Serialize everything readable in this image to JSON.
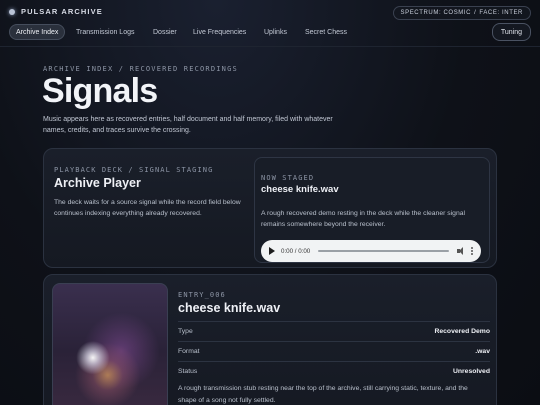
{
  "brand": {
    "name": "PULSAR ARCHIVE"
  },
  "status_pill": {
    "spectrum": "SPECTRUM: COSMIC",
    "separator": "/",
    "face": "FACE: INTER"
  },
  "nav": {
    "items": [
      {
        "label": "Archive Index",
        "active": true
      },
      {
        "label": "Transmission Logs",
        "active": false
      },
      {
        "label": "Dossier",
        "active": false
      },
      {
        "label": "Live Frequencies",
        "active": false
      },
      {
        "label": "Uplinks",
        "active": false
      },
      {
        "label": "Secret Chess",
        "active": false
      }
    ],
    "tuning_label": "Tuning"
  },
  "header": {
    "eyebrow": "ARCHIVE INDEX / RECOVERED RECORDINGS",
    "title": "Signals",
    "intro": "Music appears here as recovered entries, half document and half memory, filed with whatever names, credits, and traces survive the crossing."
  },
  "deck": {
    "eyebrow": "PLAYBACK DECK / SIGNAL STAGING",
    "title": "Archive Player",
    "description": "The deck waits for a source signal while the record field below continues indexing everything already recovered.",
    "staged": {
      "eyebrow": "NOW STAGED",
      "title": "cheese knife.wav",
      "description": "A rough recovered demo resting in the deck while the cleaner signal remains somewhere beyond the receiver.",
      "player": {
        "time": "0:00 / 0:00",
        "progress": 0
      }
    }
  },
  "entry": {
    "eyebrow": "ENTRY_006",
    "title": "cheese knife.wav",
    "meta": [
      {
        "key": "Type",
        "value": "Recovered Demo"
      },
      {
        "key": "Format",
        "value": ".wav"
      },
      {
        "key": "Status",
        "value": "Unresolved"
      }
    ],
    "description": "A rough transmission stub resting near the top of the archive, still carrying static, texture, and the shape of a song not fully settled."
  }
}
